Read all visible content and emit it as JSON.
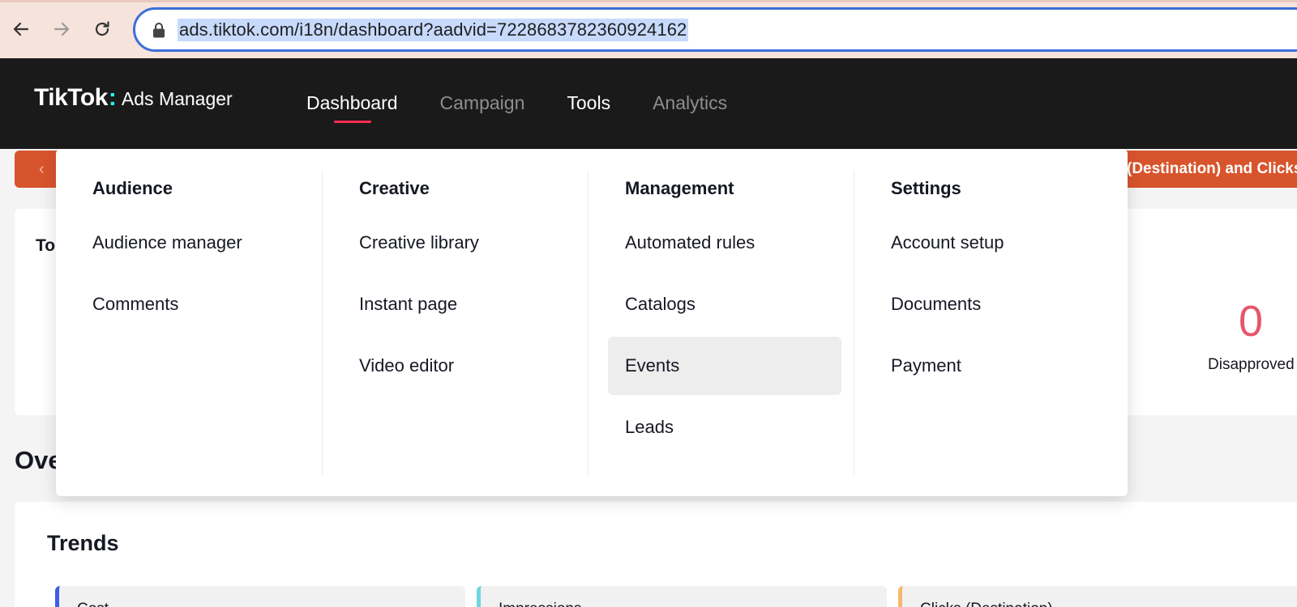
{
  "browser": {
    "url": "ads.tiktok.com/i18n/dashboard?aadvid=7228683782360924162",
    "icons": [
      "back-arrow-icon",
      "forward-arrow-icon",
      "reload-icon",
      "lock-icon"
    ]
  },
  "header": {
    "logo_main": "TikTok",
    "logo_colon": ":",
    "logo_sub": "Ads Manager",
    "nav": [
      {
        "label": "Dashboard",
        "active": true
      },
      {
        "label": "Campaign"
      },
      {
        "label": "Tools"
      },
      {
        "label": "Analytics"
      }
    ]
  },
  "banner": {
    "chevron": "‹",
    "text": "(Destination) and Clicks"
  },
  "status_card": {
    "title": "To",
    "stat_value": "0",
    "stat_label": "Disapproved"
  },
  "overview": {
    "title": "Ove"
  },
  "trends": {
    "title": "Trends",
    "metrics": [
      {
        "label": "Cost",
        "color": "#3c5fe8"
      },
      {
        "label": "Impressions",
        "color": "#6fd6dc"
      },
      {
        "label": "Clicks (Destination)",
        "color": "#f4b969"
      }
    ]
  },
  "tools_menu": {
    "columns": [
      {
        "heading": "Audience",
        "items": [
          "Audience manager",
          "Comments"
        ]
      },
      {
        "heading": "Creative",
        "items": [
          "Creative library",
          "Instant page",
          "Video editor"
        ]
      },
      {
        "heading": "Management",
        "items": [
          "Automated rules",
          "Catalogs",
          "Events",
          "Leads"
        ]
      },
      {
        "heading": "Settings",
        "items": [
          "Account setup",
          "Documents",
          "Payment"
        ]
      }
    ],
    "highlighted_item": "Events"
  },
  "colors": {
    "accent": "#fe2c55",
    "banner": "#d8542c",
    "header_bg": "#1a1a1a",
    "url_border": "#3b6fd8"
  }
}
